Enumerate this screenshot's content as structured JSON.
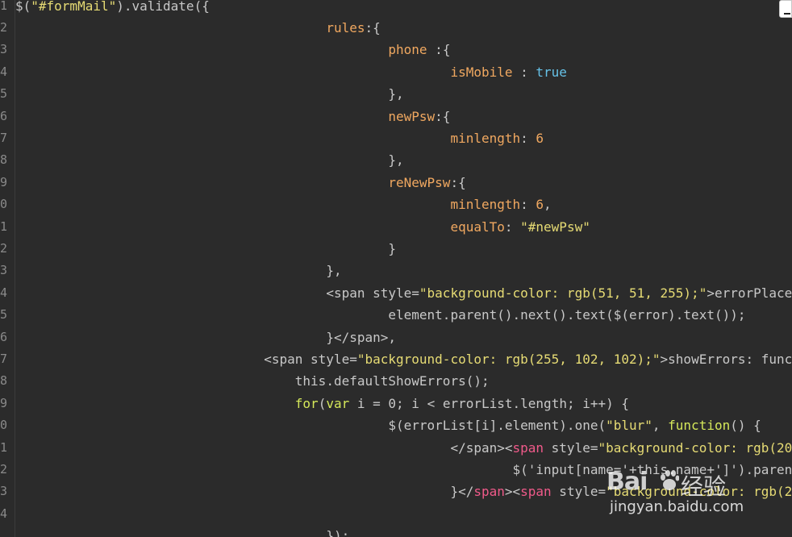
{
  "gutter": {
    "line_numbers": [
      "1",
      "2",
      "3",
      "4",
      "5",
      "6",
      "7",
      "8",
      "9",
      "0",
      "1",
      "2",
      "3",
      "4",
      "5",
      "6",
      "7",
      "8",
      "9",
      "0",
      "1",
      "2",
      "3",
      "4",
      ""
    ]
  },
  "code_lines": [
    [
      {
        "t": "$(",
        "c": "plain"
      },
      {
        "t": "\"#formMail\"",
        "c": "str"
      },
      {
        "t": ").validate({",
        "c": "plain"
      }
    ],
    [
      {
        "t": "                                        ",
        "c": "plain"
      },
      {
        "t": "rules",
        "c": "key"
      },
      {
        "t": ":{",
        "c": "plain"
      }
    ],
    [
      {
        "t": "                                                ",
        "c": "plain"
      },
      {
        "t": "phone",
        "c": "key"
      },
      {
        "t": " :{",
        "c": "plain"
      }
    ],
    [
      {
        "t": "                                                        ",
        "c": "plain"
      },
      {
        "t": "isMobile",
        "c": "key"
      },
      {
        "t": " : ",
        "c": "plain"
      },
      {
        "t": "true",
        "c": "bool"
      }
    ],
    [
      {
        "t": "                                                ",
        "c": "plain"
      },
      {
        "t": "},",
        "c": "plain"
      }
    ],
    [
      {
        "t": "                                                ",
        "c": "plain"
      },
      {
        "t": "newPsw",
        "c": "key"
      },
      {
        "t": ":{",
        "c": "plain"
      }
    ],
    [
      {
        "t": "                                                        ",
        "c": "plain"
      },
      {
        "t": "minlength",
        "c": "key"
      },
      {
        "t": ": ",
        "c": "plain"
      },
      {
        "t": "6",
        "c": "num"
      }
    ],
    [
      {
        "t": "                                                ",
        "c": "plain"
      },
      {
        "t": "},",
        "c": "plain"
      }
    ],
    [
      {
        "t": "                                                ",
        "c": "plain"
      },
      {
        "t": "reNewPsw",
        "c": "key"
      },
      {
        "t": ":{",
        "c": "plain"
      }
    ],
    [
      {
        "t": "                                                        ",
        "c": "plain"
      },
      {
        "t": "minlength",
        "c": "key"
      },
      {
        "t": ": ",
        "c": "plain"
      },
      {
        "t": "6",
        "c": "num"
      },
      {
        "t": ",",
        "c": "plain"
      }
    ],
    [
      {
        "t": "                                                        ",
        "c": "plain"
      },
      {
        "t": "equalTo",
        "c": "key"
      },
      {
        "t": ": ",
        "c": "plain"
      },
      {
        "t": "\"#newPsw\"",
        "c": "str"
      }
    ],
    [
      {
        "t": "                                                ",
        "c": "plain"
      },
      {
        "t": "}",
        "c": "plain"
      }
    ],
    [
      {
        "t": "                                        ",
        "c": "plain"
      },
      {
        "t": "},",
        "c": "plain"
      }
    ],
    [
      {
        "t": "                                        ",
        "c": "plain"
      },
      {
        "t": "<span style=",
        "c": "plain"
      },
      {
        "t": "\"background-color: rgb(51, 51, 255);\"",
        "c": "str"
      },
      {
        "t": ">errorPlace",
        "c": "plain"
      }
    ],
    [
      {
        "t": "                                                ",
        "c": "plain"
      },
      {
        "t": "element.parent().next().text($(error).text());",
        "c": "plain"
      }
    ],
    [
      {
        "t": "                                        ",
        "c": "plain"
      },
      {
        "t": "}</span>,",
        "c": "plain"
      }
    ],
    [
      {
        "t": "                                ",
        "c": "plain"
      },
      {
        "t": "<span style=",
        "c": "plain"
      },
      {
        "t": "\"background-color: rgb(255, 102, 102);\"",
        "c": "str"
      },
      {
        "t": ">showErrors: func",
        "c": "plain"
      }
    ],
    [
      {
        "t": "                                    ",
        "c": "plain"
      },
      {
        "t": "this.defaultShowErrors();",
        "c": "plain"
      }
    ],
    [
      {
        "t": "                                    ",
        "c": "plain"
      },
      {
        "t": "for",
        "c": "kw"
      },
      {
        "t": "(",
        "c": "plain"
      },
      {
        "t": "var",
        "c": "kw"
      },
      {
        "t": " i = 0; i < errorList.length; i++) {",
        "c": "plain"
      }
    ],
    [
      {
        "t": "                                                ",
        "c": "plain"
      },
      {
        "t": "$(errorList[i].element).one(",
        "c": "plain"
      },
      {
        "t": "\"blur\"",
        "c": "str"
      },
      {
        "t": ", ",
        "c": "plain"
      },
      {
        "t": "function",
        "c": "kw"
      },
      {
        "t": "() {",
        "c": "plain"
      }
    ],
    [
      {
        "t": "                                                        ",
        "c": "plain"
      },
      {
        "t": "</span><",
        "c": "plain"
      },
      {
        "t": "span",
        "c": "tag"
      },
      {
        "t": " style=",
        "c": "plain"
      },
      {
        "t": "\"background-color: rgb(20",
        "c": "str"
      }
    ],
    [
      {
        "t": "                                                                ",
        "c": "plain"
      },
      {
        "t": "$('input[name='+this.name+']').paren",
        "c": "plain"
      }
    ],
    [
      {
        "t": "                                                        ",
        "c": "plain"
      },
      {
        "t": "}</",
        "c": "plain"
      },
      {
        "t": "span",
        "c": "tag"
      },
      {
        "t": "><",
        "c": "plain"
      },
      {
        "t": "span",
        "c": "tag"
      },
      {
        "t": " style=",
        "c": "plain"
      },
      {
        "t": "\"background-color: rgb(2",
        "c": "str"
      }
    ],
    [],
    [
      {
        "t": "                                        ",
        "c": "plain"
      },
      {
        "t": "});",
        "c": "plain"
      }
    ]
  ],
  "watermark": {
    "brand": "Bai",
    "brand_cn": "经验",
    "url": "jingyan.baidu.com"
  },
  "colors": {
    "background": "#2b2b2b",
    "plain": "#c8c8c8",
    "string": "#e6db74",
    "key": "#f0a860",
    "boolean": "#66c2e8",
    "tag": "#f05a8a",
    "keyword": "#d5e85a"
  }
}
